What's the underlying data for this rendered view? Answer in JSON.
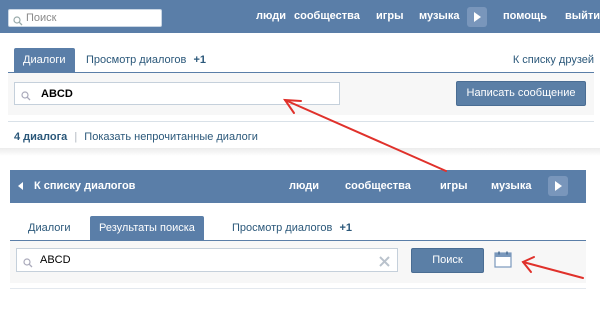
{
  "top_panel": {
    "search_placeholder": "Поиск",
    "nav": [
      "люди",
      "сообщества",
      "игры",
      "музыка",
      "помощь",
      "выйти"
    ],
    "tabs": [
      {
        "label": "Диалоги",
        "active": true
      },
      {
        "label": "Просмотр диалогов",
        "badge": "+1"
      }
    ],
    "friends_link": "К списку друзей",
    "search_value": "ABCD",
    "write_button": "Написать сообщение",
    "dialog_count": "4 диалога",
    "unread_link": "Показать непрочитанные диалоги"
  },
  "bottom_panel": {
    "back_label": "К списку диалогов",
    "nav": [
      "люди",
      "сообщества",
      "игры",
      "музыка"
    ],
    "tabs": [
      {
        "label": "Диалоги"
      },
      {
        "label": "Результаты поиска",
        "active": true
      },
      {
        "label": "Просмотр диалогов",
        "badge": "+1"
      }
    ],
    "search_value": "ABCD",
    "search_button": "Поиск"
  },
  "colors": {
    "header_blue": "#5a7ea8",
    "link_blue": "#2b587a",
    "arrow_red": "#e0312b"
  },
  "icons": [
    "search-icon",
    "play-icon",
    "back-arrow-icon",
    "clear-icon",
    "calendar-icon"
  ]
}
